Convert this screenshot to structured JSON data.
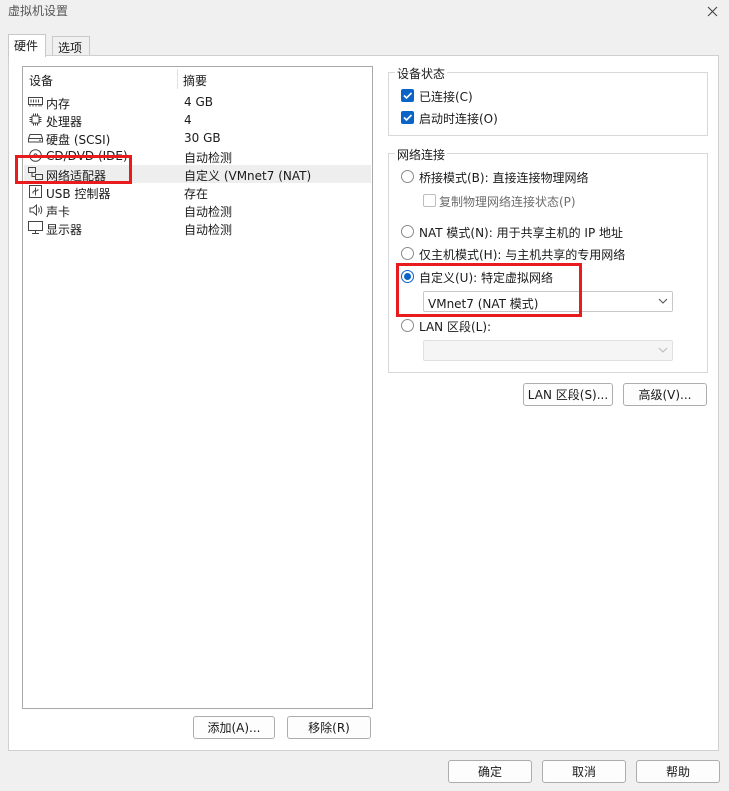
{
  "window": {
    "title": "虚拟机设置"
  },
  "tabs": [
    {
      "label": "硬件"
    },
    {
      "label": "选项"
    }
  ],
  "device_list": {
    "headers": {
      "device": "设备",
      "summary": "摘要"
    },
    "rows": [
      {
        "name": "内存",
        "summary": "4 GB",
        "icon": "memory-icon"
      },
      {
        "name": "处理器",
        "summary": "4",
        "icon": "processor-icon"
      },
      {
        "name": "硬盘 (SCSI)",
        "summary": "30 GB",
        "icon": "hard-disk-icon"
      },
      {
        "name": "CD/DVD (IDE)",
        "summary": "自动检测",
        "icon": "cd-dvd-icon"
      },
      {
        "name": "网络适配器",
        "summary": "自定义 (VMnet7 (NAT)",
        "icon": "network-adapter-icon",
        "selected": true
      },
      {
        "name": "USB 控制器",
        "summary": "存在",
        "icon": "usb-controller-icon"
      },
      {
        "name": "声卡",
        "summary": "自动检测",
        "icon": "sound-card-icon"
      },
      {
        "name": "显示器",
        "summary": "自动检测",
        "icon": "display-icon"
      }
    ],
    "add_label": "添加(A)...",
    "remove_label": "移除(R)"
  },
  "device_status": {
    "title": "设备状态",
    "connected_label": "已连接(C)",
    "connected": true,
    "connect_at_power_on_label": "启动时连接(O)",
    "connect_at_power_on": true
  },
  "network_connection": {
    "title": "网络连接",
    "bridged_label": "桥接模式(B): 直接连接物理网络",
    "replicate_label": "复制物理网络连接状态(P)",
    "nat_label": "NAT 模式(N): 用于共享主机的 IP 地址",
    "host_only_label": "仅主机模式(H): 与主机共享的专用网络",
    "custom_label": "自定义(U): 特定虚拟网络",
    "custom_value": "VMnet7 (NAT 模式)",
    "lan_segment_label": "LAN 区段(L):",
    "lan_segment_value": "",
    "selected": "custom"
  },
  "lan_segments_button": "LAN 区段(S)...",
  "advanced_button": "高级(V)...",
  "footer": {
    "ok": "确定",
    "cancel": "取消",
    "help": "帮助"
  },
  "colors": {
    "accent": "#0a64c8",
    "highlight_box": "#e81c1c"
  }
}
